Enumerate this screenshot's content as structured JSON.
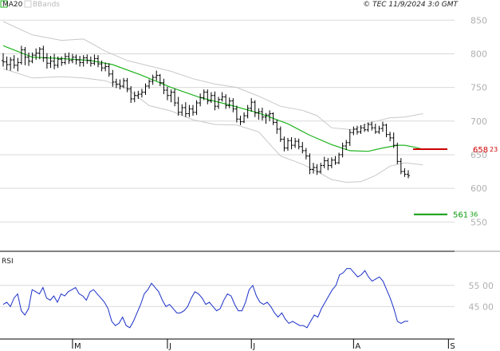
{
  "legend": {
    "ma_label": "MA20",
    "bb_label": "BBands"
  },
  "copyright": "© TEC 11/9/2024 3:0 GMT",
  "rsi_panel": {
    "title": "RSI"
  },
  "colors": {
    "ma": "#1fb41f",
    "bands": "#c8c8c8",
    "price": "#000000",
    "resistance": "#cc0000",
    "support": "#0b9a0b",
    "rsi": "#1a2fc8",
    "grid": "#d9d9d9",
    "axis_text": "#b0b0b0"
  },
  "chart_data": [
    {
      "type": "ohlc",
      "name": "price",
      "y_ticks": [
        550,
        600,
        650,
        700,
        750,
        800,
        850
      ],
      "y_tick_labels": [
        "550",
        "600",
        "650",
        "700",
        "750",
        "800",
        "850"
      ],
      "ylim": [
        510,
        880
      ],
      "x_ticks": [
        {
          "index": 19,
          "label": "M"
        },
        {
          "index": 45,
          "label": "J"
        },
        {
          "index": 68,
          "label": "J"
        },
        {
          "index": 96,
          "label": "A"
        },
        {
          "index": 122,
          "label": "S"
        }
      ],
      "levels": [
        {
          "name": "resistance",
          "value": 658.23,
          "label_main": "658",
          "label_frac": "23"
        },
        {
          "name": "support",
          "value": 561.36,
          "label_main": "561",
          "label_frac": "36"
        }
      ],
      "bars": [
        {
          "o": 790,
          "h": 801,
          "l": 781,
          "c": 788
        },
        {
          "o": 788,
          "h": 796,
          "l": 776,
          "c": 784
        },
        {
          "o": 784,
          "h": 795,
          "l": 775,
          "c": 791
        },
        {
          "o": 791,
          "h": 798,
          "l": 778,
          "c": 783
        },
        {
          "o": 783,
          "h": 794,
          "l": 774,
          "c": 787
        },
        {
          "o": 787,
          "h": 812,
          "l": 784,
          "c": 806
        },
        {
          "o": 806,
          "h": 810,
          "l": 783,
          "c": 795
        },
        {
          "o": 795,
          "h": 802,
          "l": 782,
          "c": 789
        },
        {
          "o": 789,
          "h": 802,
          "l": 786,
          "c": 798
        },
        {
          "o": 798,
          "h": 808,
          "l": 791,
          "c": 801
        },
        {
          "o": 801,
          "h": 810,
          "l": 792,
          "c": 807
        },
        {
          "o": 807,
          "h": 812,
          "l": 788,
          "c": 794
        },
        {
          "o": 794,
          "h": 801,
          "l": 778,
          "c": 786
        },
        {
          "o": 786,
          "h": 797,
          "l": 779,
          "c": 789
        },
        {
          "o": 789,
          "h": 800,
          "l": 777,
          "c": 783
        },
        {
          "o": 783,
          "h": 796,
          "l": 779,
          "c": 792
        },
        {
          "o": 792,
          "h": 796,
          "l": 782,
          "c": 787
        },
        {
          "o": 787,
          "h": 801,
          "l": 784,
          "c": 796
        },
        {
          "o": 796,
          "h": 802,
          "l": 785,
          "c": 790
        },
        {
          "o": 790,
          "h": 800,
          "l": 786,
          "c": 795
        },
        {
          "o": 795,
          "h": 799,
          "l": 784,
          "c": 791
        },
        {
          "o": 791,
          "h": 797,
          "l": 781,
          "c": 787
        },
        {
          "o": 787,
          "h": 798,
          "l": 781,
          "c": 794
        },
        {
          "o": 794,
          "h": 799,
          "l": 785,
          "c": 790
        },
        {
          "o": 790,
          "h": 796,
          "l": 781,
          "c": 786
        },
        {
          "o": 786,
          "h": 799,
          "l": 783,
          "c": 793
        },
        {
          "o": 793,
          "h": 798,
          "l": 780,
          "c": 785
        },
        {
          "o": 785,
          "h": 790,
          "l": 774,
          "c": 779
        },
        {
          "o": 779,
          "h": 787,
          "l": 774,
          "c": 781
        },
        {
          "o": 781,
          "h": 786,
          "l": 766,
          "c": 770
        },
        {
          "o": 770,
          "h": 776,
          "l": 751,
          "c": 758
        },
        {
          "o": 758,
          "h": 763,
          "l": 749,
          "c": 755
        },
        {
          "o": 755,
          "h": 762,
          "l": 747,
          "c": 752
        },
        {
          "o": 752,
          "h": 764,
          "l": 749,
          "c": 760
        },
        {
          "o": 760,
          "h": 764,
          "l": 743,
          "c": 748
        },
        {
          "o": 748,
          "h": 752,
          "l": 727,
          "c": 733
        },
        {
          "o": 733,
          "h": 744,
          "l": 728,
          "c": 738
        },
        {
          "o": 738,
          "h": 745,
          "l": 733,
          "c": 740
        },
        {
          "o": 740,
          "h": 748,
          "l": 735,
          "c": 743
        },
        {
          "o": 743,
          "h": 756,
          "l": 739,
          "c": 752
        },
        {
          "o": 752,
          "h": 762,
          "l": 748,
          "c": 759
        },
        {
          "o": 759,
          "h": 769,
          "l": 754,
          "c": 765
        },
        {
          "o": 765,
          "h": 775,
          "l": 760,
          "c": 768
        },
        {
          "o": 768,
          "h": 770,
          "l": 752,
          "c": 757
        },
        {
          "o": 757,
          "h": 763,
          "l": 740,
          "c": 746
        },
        {
          "o": 746,
          "h": 751,
          "l": 731,
          "c": 738
        },
        {
          "o": 738,
          "h": 747,
          "l": 728,
          "c": 743
        },
        {
          "o": 743,
          "h": 748,
          "l": 722,
          "c": 727
        },
        {
          "o": 727,
          "h": 736,
          "l": 708,
          "c": 713
        },
        {
          "o": 713,
          "h": 725,
          "l": 708,
          "c": 720
        },
        {
          "o": 720,
          "h": 728,
          "l": 706,
          "c": 711
        },
        {
          "o": 711,
          "h": 724,
          "l": 706,
          "c": 718
        },
        {
          "o": 718,
          "h": 724,
          "l": 708,
          "c": 713
        },
        {
          "o": 713,
          "h": 731,
          "l": 709,
          "c": 727
        },
        {
          "o": 727,
          "h": 741,
          "l": 722,
          "c": 735
        },
        {
          "o": 735,
          "h": 747,
          "l": 731,
          "c": 743
        },
        {
          "o": 743,
          "h": 747,
          "l": 725,
          "c": 730
        },
        {
          "o": 730,
          "h": 743,
          "l": 727,
          "c": 738
        },
        {
          "o": 738,
          "h": 744,
          "l": 716,
          "c": 722
        },
        {
          "o": 722,
          "h": 736,
          "l": 718,
          "c": 732
        },
        {
          "o": 732,
          "h": 743,
          "l": 729,
          "c": 736
        },
        {
          "o": 736,
          "h": 740,
          "l": 718,
          "c": 723
        },
        {
          "o": 723,
          "h": 735,
          "l": 719,
          "c": 730
        },
        {
          "o": 730,
          "h": 734,
          "l": 713,
          "c": 718
        },
        {
          "o": 718,
          "h": 723,
          "l": 698,
          "c": 703
        },
        {
          "o": 703,
          "h": 708,
          "l": 694,
          "c": 699
        },
        {
          "o": 699,
          "h": 713,
          "l": 697,
          "c": 708
        },
        {
          "o": 708,
          "h": 724,
          "l": 704,
          "c": 719
        },
        {
          "o": 719,
          "h": 734,
          "l": 714,
          "c": 728
        },
        {
          "o": 728,
          "h": 731,
          "l": 706,
          "c": 712
        },
        {
          "o": 712,
          "h": 719,
          "l": 702,
          "c": 714
        },
        {
          "o": 714,
          "h": 720,
          "l": 701,
          "c": 706
        },
        {
          "o": 706,
          "h": 712,
          "l": 696,
          "c": 709
        },
        {
          "o": 709,
          "h": 716,
          "l": 700,
          "c": 711
        },
        {
          "o": 711,
          "h": 713,
          "l": 694,
          "c": 698
        },
        {
          "o": 698,
          "h": 702,
          "l": 681,
          "c": 688
        },
        {
          "o": 688,
          "h": 692,
          "l": 669,
          "c": 673
        },
        {
          "o": 673,
          "h": 677,
          "l": 655,
          "c": 660
        },
        {
          "o": 660,
          "h": 675,
          "l": 656,
          "c": 671
        },
        {
          "o": 671,
          "h": 676,
          "l": 658,
          "c": 664
        },
        {
          "o": 664,
          "h": 675,
          "l": 660,
          "c": 670
        },
        {
          "o": 670,
          "h": 674,
          "l": 658,
          "c": 662
        },
        {
          "o": 662,
          "h": 669,
          "l": 652,
          "c": 656
        },
        {
          "o": 656,
          "h": 660,
          "l": 643,
          "c": 648
        },
        {
          "o": 648,
          "h": 652,
          "l": 621,
          "c": 628
        },
        {
          "o": 628,
          "h": 638,
          "l": 622,
          "c": 631
        },
        {
          "o": 631,
          "h": 636,
          "l": 620,
          "c": 625
        },
        {
          "o": 625,
          "h": 638,
          "l": 622,
          "c": 634
        },
        {
          "o": 634,
          "h": 647,
          "l": 630,
          "c": 641
        },
        {
          "o": 641,
          "h": 645,
          "l": 627,
          "c": 634
        },
        {
          "o": 634,
          "h": 646,
          "l": 630,
          "c": 642
        },
        {
          "o": 642,
          "h": 648,
          "l": 635,
          "c": 638
        },
        {
          "o": 638,
          "h": 653,
          "l": 636,
          "c": 650
        },
        {
          "o": 650,
          "h": 668,
          "l": 646,
          "c": 663
        },
        {
          "o": 663,
          "h": 672,
          "l": 657,
          "c": 668
        },
        {
          "o": 668,
          "h": 688,
          "l": 663,
          "c": 683
        },
        {
          "o": 683,
          "h": 692,
          "l": 679,
          "c": 688
        },
        {
          "o": 688,
          "h": 693,
          "l": 680,
          "c": 684
        },
        {
          "o": 684,
          "h": 694,
          "l": 681,
          "c": 690
        },
        {
          "o": 690,
          "h": 696,
          "l": 684,
          "c": 687
        },
        {
          "o": 687,
          "h": 698,
          "l": 684,
          "c": 695
        },
        {
          "o": 695,
          "h": 699,
          "l": 686,
          "c": 690
        },
        {
          "o": 690,
          "h": 696,
          "l": 681,
          "c": 684
        },
        {
          "o": 684,
          "h": 693,
          "l": 681,
          "c": 689
        },
        {
          "o": 689,
          "h": 699,
          "l": 684,
          "c": 694
        },
        {
          "o": 694,
          "h": 696,
          "l": 676,
          "c": 680
        },
        {
          "o": 680,
          "h": 684,
          "l": 670,
          "c": 675
        },
        {
          "o": 675,
          "h": 683,
          "l": 660,
          "c": 664
        },
        {
          "o": 664,
          "h": 668,
          "l": 636,
          "c": 640
        },
        {
          "o": 640,
          "h": 645,
          "l": 621,
          "c": 625
        },
        {
          "o": 625,
          "h": 630,
          "l": 617,
          "c": 621
        },
        {
          "o": 621,
          "h": 627,
          "l": 615,
          "c": 619
        }
      ],
      "ma20": [
        [
          0,
          812
        ],
        [
          8,
          795
        ],
        [
          16,
          793
        ],
        [
          24,
          790
        ],
        [
          30,
          784
        ],
        [
          38,
          768
        ],
        [
          46,
          750
        ],
        [
          54,
          735
        ],
        [
          62,
          724
        ],
        [
          70,
          712
        ],
        [
          78,
          696
        ],
        [
          84,
          679
        ],
        [
          90,
          665
        ],
        [
          95,
          656
        ],
        [
          100,
          655
        ],
        [
          104,
          660
        ],
        [
          108,
          664
        ],
        [
          110,
          664
        ],
        [
          113,
          661
        ],
        [
          115,
          658
        ]
      ],
      "bb_upper": [
        [
          0,
          848
        ],
        [
          8,
          828
        ],
        [
          16,
          820
        ],
        [
          22,
          822
        ],
        [
          28,
          804
        ],
        [
          34,
          790
        ],
        [
          40,
          782
        ],
        [
          46,
          774
        ],
        [
          52,
          763
        ],
        [
          58,
          755
        ],
        [
          64,
          750
        ],
        [
          70,
          737
        ],
        [
          76,
          722
        ],
        [
          82,
          716
        ],
        [
          86,
          708
        ],
        [
          90,
          690
        ],
        [
          96,
          687
        ],
        [
          100,
          697
        ],
        [
          106,
          705
        ],
        [
          110,
          706
        ],
        [
          115,
          711
        ]
      ],
      "bb_lower": [
        [
          0,
          778
        ],
        [
          8,
          764
        ],
        [
          16,
          766
        ],
        [
          22,
          764
        ],
        [
          28,
          760
        ],
        [
          34,
          748
        ],
        [
          40,
          723
        ],
        [
          46,
          715
        ],
        [
          52,
          702
        ],
        [
          58,
          695
        ],
        [
          64,
          694
        ],
        [
          70,
          684
        ],
        [
          76,
          648
        ],
        [
          82,
          636
        ],
        [
          86,
          625
        ],
        [
          90,
          613
        ],
        [
          94,
          609
        ],
        [
          98,
          610
        ],
        [
          102,
          619
        ],
        [
          106,
          633
        ],
        [
          110,
          638
        ],
        [
          115,
          635
        ]
      ]
    },
    {
      "type": "line",
      "name": "RSI",
      "y_ticks": [
        45,
        55
      ],
      "y_tick_labels": [
        "45 00",
        "55 00"
      ],
      "ylim": [
        30,
        70
      ],
      "values": [
        46,
        47,
        45,
        49,
        51,
        43,
        41,
        44,
        53,
        52,
        51,
        54,
        49,
        48,
        50,
        47,
        51,
        50,
        52,
        53,
        54,
        51,
        50,
        48,
        52,
        53,
        51,
        49,
        47,
        44,
        38,
        36,
        37,
        40,
        36,
        35,
        38,
        42,
        46,
        51,
        53,
        56,
        54,
        52,
        48,
        45,
        46,
        44,
        42,
        42,
        43,
        45,
        49,
        52,
        51,
        49,
        46,
        47,
        45,
        43,
        44,
        48,
        51,
        50,
        46,
        43,
        43,
        47,
        53,
        55,
        50,
        47,
        46,
        47,
        45,
        42,
        40,
        42,
        39,
        37,
        38,
        37,
        36,
        36,
        35,
        38,
        41,
        40,
        44,
        47,
        50,
        53,
        55,
        60,
        61,
        63,
        63,
        61,
        59,
        60,
        62,
        59,
        57,
        58,
        59,
        57,
        53,
        49,
        44,
        38,
        37,
        38,
        38
      ]
    }
  ]
}
